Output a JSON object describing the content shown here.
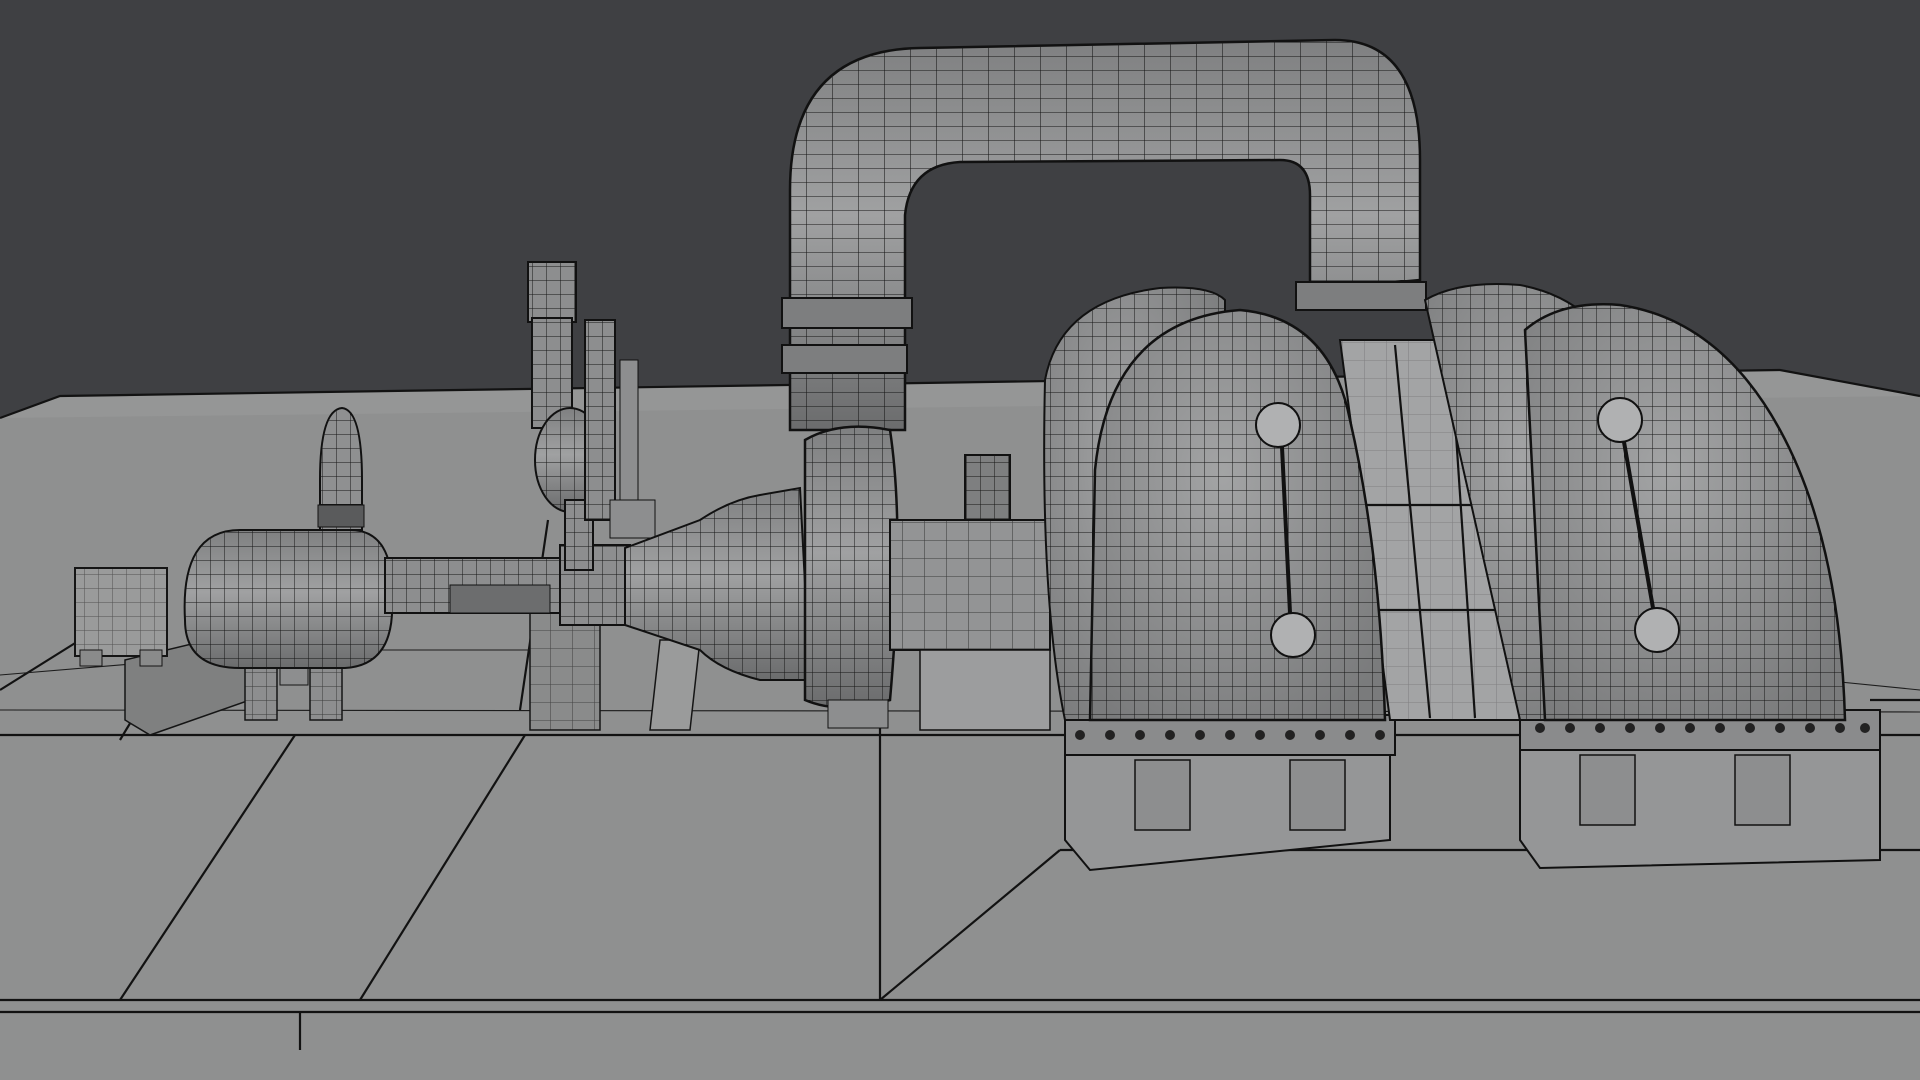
{
  "viewport": {
    "background_color": "#3f4043",
    "floor_color": "#8f9090",
    "mesh_surface_color": "#8d8e8f",
    "wire_color": "#1c1c1c"
  },
  "scene": {
    "icon": "turbine-generator-wireframe-model"
  }
}
